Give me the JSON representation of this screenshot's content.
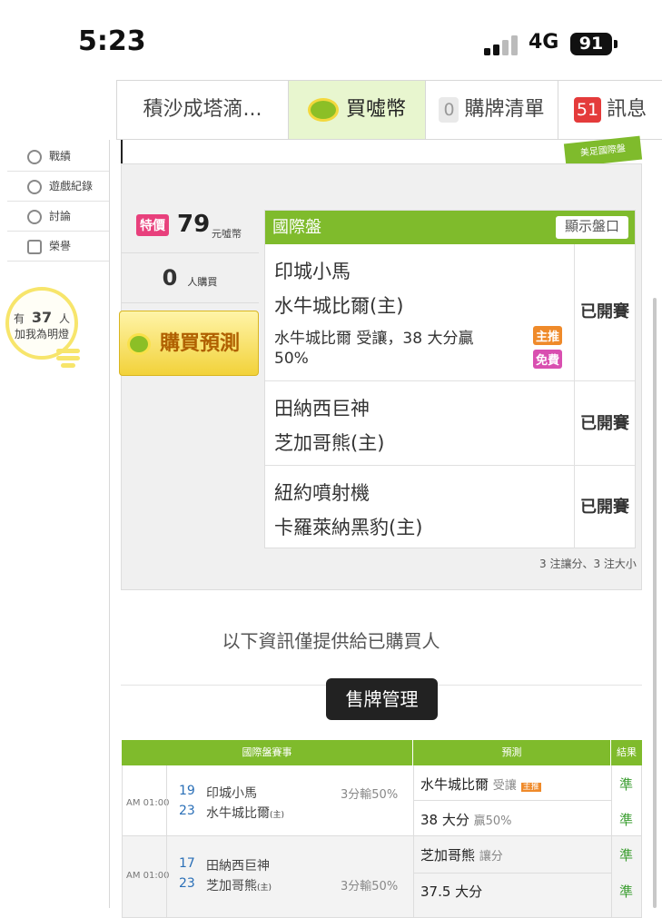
{
  "status": {
    "time": "5:23",
    "network": "4G",
    "battery": "91"
  },
  "tabs": [
    {
      "label": "積沙成塔滴..."
    },
    {
      "label": "買噓幣"
    },
    {
      "count": "0",
      "label": "購牌清單"
    },
    {
      "count": "51",
      "label": "訊息"
    }
  ],
  "sidebar": {
    "items": [
      "戰績",
      "遊戲紀錄",
      "討論",
      "榮譽"
    ],
    "bulb": {
      "prefix": "有",
      "count": "37",
      "suffix": "人",
      "text": "加我為明燈"
    }
  },
  "banner_text": "美足國際盤",
  "offer": {
    "special_label": "特價",
    "price": "79",
    "price_unit": "元噓幣",
    "buyers": "0",
    "buyers_unit": "人購買",
    "buy_button": "購買預測"
  },
  "bet": {
    "title": "國際盤",
    "show_button": "顯示盤口",
    "matches": [
      {
        "away": "印城小馬",
        "home": "水牛城比爾(主)",
        "pick_line1": "水牛城比爾 受讓，38 大分贏",
        "pick_line2": "50%",
        "tag_main": "主推",
        "tag_free": "免費",
        "status": "已開賽"
      },
      {
        "away": "田納西巨神",
        "home": "芝加哥熊(主)",
        "status": "已開賽"
      },
      {
        "away": "紐約噴射機",
        "home": "卡羅萊納黑豹(主)",
        "status": "已開賽"
      }
    ],
    "footnote": "3 注讓分、3 注大小"
  },
  "info_text": "以下資訊僅提供給已購買人",
  "manage_button": "售牌管理",
  "table": {
    "headers": {
      "event": "國際盤賽事",
      "prediction": "預測",
      "result": "結果"
    },
    "rows": [
      {
        "time": "AM 01:00",
        "num1": "19",
        "team1": "印城小馬",
        "num2": "23",
        "team2": "水牛城比爾",
        "host": "(主)",
        "odds": "3分輸50%",
        "pred1": "水牛城比爾",
        "pred1_note": "受讓",
        "pred1_tag": "主推",
        "res1": "準",
        "pred2": "38 大分",
        "pred2_note": "贏50%",
        "res2": "準"
      },
      {
        "time": "AM 01:00",
        "num1": "17",
        "team1": "田納西巨神",
        "num2": "23",
        "team2": "芝加哥熊",
        "host": "(主)",
        "odds": "3分輸50%",
        "pred1": "芝加哥熊",
        "pred1_note": "讓分",
        "res1": "準",
        "pred2": "37.5 大分",
        "pred2_note": "",
        "res2": "準"
      }
    ]
  }
}
